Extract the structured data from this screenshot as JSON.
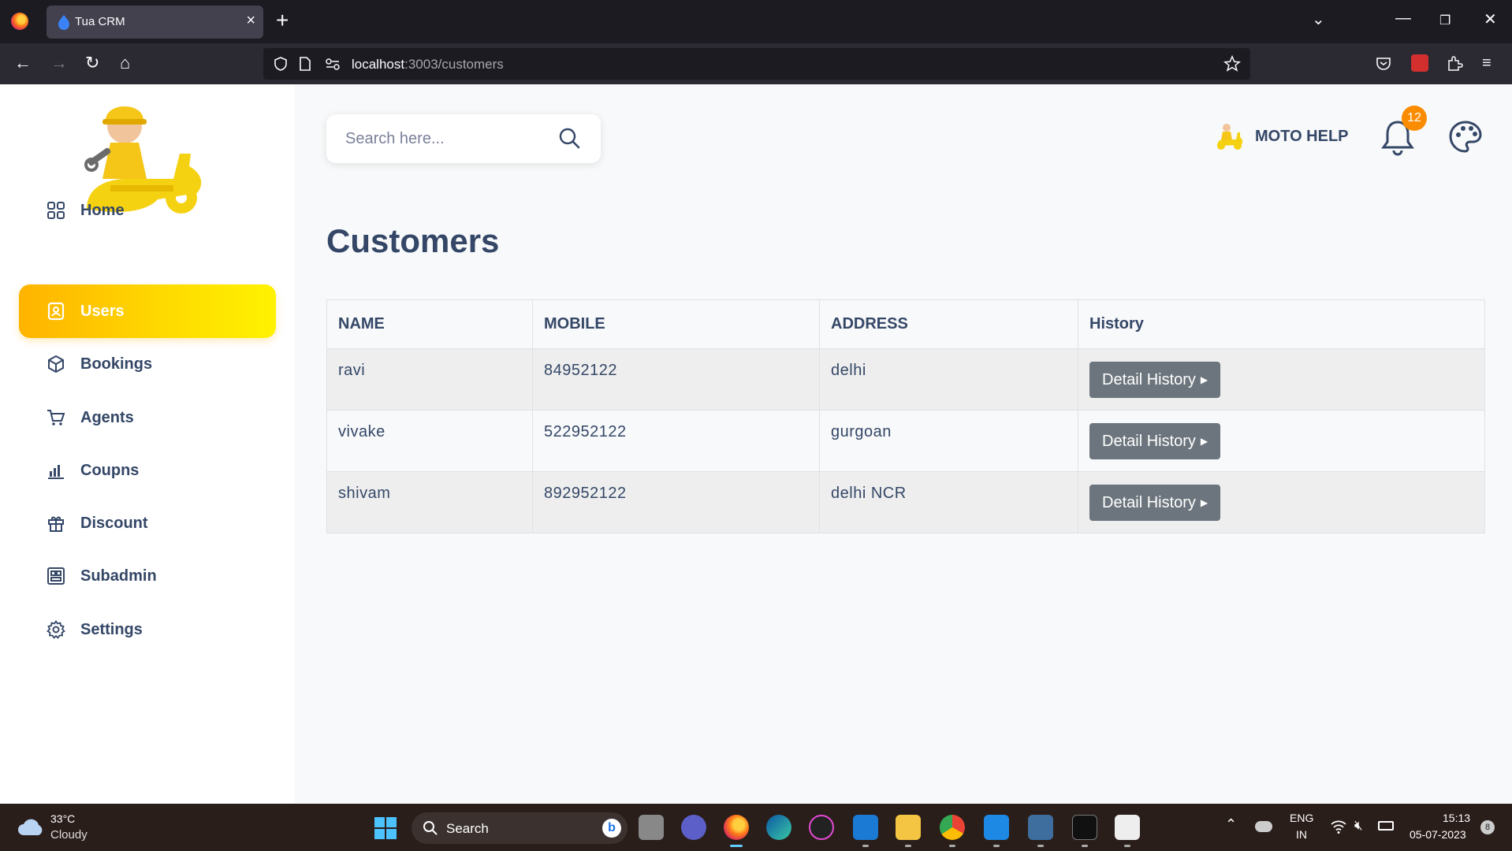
{
  "browser": {
    "tab_title": "Tua CRM",
    "url_host": "localhost",
    "url_rest": ":3003/customers"
  },
  "sidebar": {
    "items": [
      {
        "label": "Home",
        "icon": "grid-icon"
      },
      {
        "label": "Users",
        "icon": "user-badge-icon",
        "active": true
      },
      {
        "label": "Bookings",
        "icon": "box-icon"
      },
      {
        "label": "Agents",
        "icon": "cart-icon"
      },
      {
        "label": "Coupns",
        "icon": "bar-chart-icon"
      },
      {
        "label": "Discount",
        "icon": "gift-icon"
      },
      {
        "label": "Subadmin",
        "icon": "layout-icon"
      },
      {
        "label": "Settings",
        "icon": "gear-icon"
      }
    ],
    "accent_gradient": [
      "#ffb300",
      "#fff200"
    ]
  },
  "header": {
    "search_placeholder": "Search here...",
    "brand_name": "MOTO HELP",
    "notification_count": "12"
  },
  "main": {
    "title": "Customers",
    "table": {
      "columns": [
        "NAME",
        "MOBILE",
        "ADDRESS",
        "History"
      ],
      "rows": [
        {
          "name": "ravi",
          "mobile": "84952122",
          "address": "delhi",
          "action": "Detail History"
        },
        {
          "name": "vivake",
          "mobile": "522952122",
          "address": "gurgoan",
          "action": "Detail History"
        },
        {
          "name": "shivam",
          "mobile": "892952122",
          "address": "delhi NCR",
          "action": "Detail History"
        }
      ]
    }
  },
  "taskbar": {
    "weather_temp": "33°C",
    "weather_desc": "Cloudy",
    "search_label": "Search",
    "lang_top": "ENG",
    "lang_bottom": "IN",
    "time": "15:13",
    "date": "05-07-2023",
    "notif_count": "8"
  }
}
